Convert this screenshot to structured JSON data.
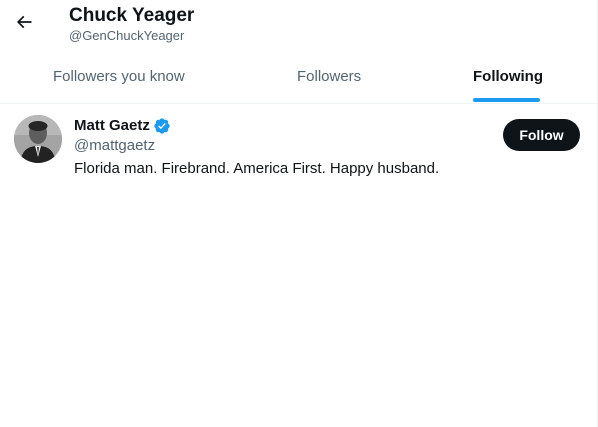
{
  "header": {
    "title": "Chuck Yeager",
    "subtitle": "@GenChuckYeager",
    "back_icon": "arrow-left-icon"
  },
  "tabs": [
    {
      "label": "Followers you know",
      "active": false
    },
    {
      "label": "Followers",
      "active": false
    },
    {
      "label": "Following",
      "active": true
    }
  ],
  "users": [
    {
      "name": "Matt Gaetz",
      "verified": true,
      "handle": "@mattgaetz",
      "bio": "Florida man. Firebrand. America First. Happy husband.",
      "follow_label": "Follow"
    }
  ],
  "colors": {
    "accent": "#1d9bf0",
    "text_primary": "#0f1419",
    "text_secondary": "#536471",
    "divider": "#eff3f4",
    "button_bg": "#0f1419"
  }
}
